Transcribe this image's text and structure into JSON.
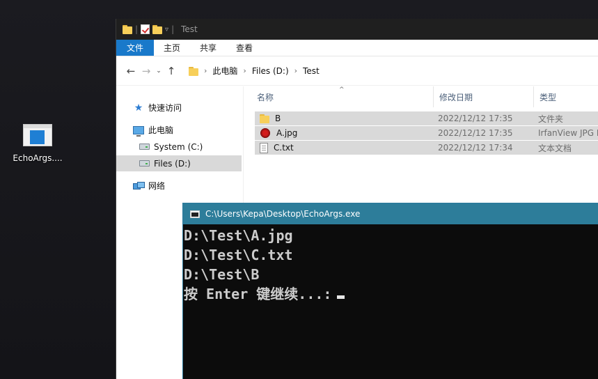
{
  "desktop": {
    "icon_label": "EchoArgs...."
  },
  "explorer": {
    "title": "Test",
    "ribbon_tabs": [
      "文件",
      "主页",
      "共享",
      "查看"
    ],
    "address": [
      "此电脑",
      "Files (D:)",
      "Test"
    ],
    "nav": {
      "quick_access": "快速访问",
      "this_pc": "此电脑",
      "system_c": "System (C:)",
      "files_d": "Files (D:)",
      "network": "网络"
    },
    "columns": {
      "name": "名称",
      "date": "修改日期",
      "type": "类型"
    },
    "files": [
      {
        "name": "B",
        "date": "2022/12/12 17:35",
        "type": "文件夹",
        "icon": "folder-icon"
      },
      {
        "name": "A.jpg",
        "date": "2022/12/12 17:35",
        "type": "IrfanView JPG F",
        "icon": "irfanview-jpg-icon"
      },
      {
        "name": "C.txt",
        "date": "2022/12/12 17:34",
        "type": "文本文档",
        "icon": "text-file-icon"
      }
    ]
  },
  "console": {
    "title": "C:\\Users\\Kepa\\Desktop\\EchoArgs.exe",
    "lines": [
      "D:\\Test\\A.jpg",
      "D:\\Test\\C.txt",
      "D:\\Test\\B",
      "按 Enter 键继续...:"
    ]
  },
  "colors": {
    "ribbon_file_tab": "#1979ca",
    "console_titlebar": "#2d7d9a",
    "selection": "#d9d9d9"
  }
}
